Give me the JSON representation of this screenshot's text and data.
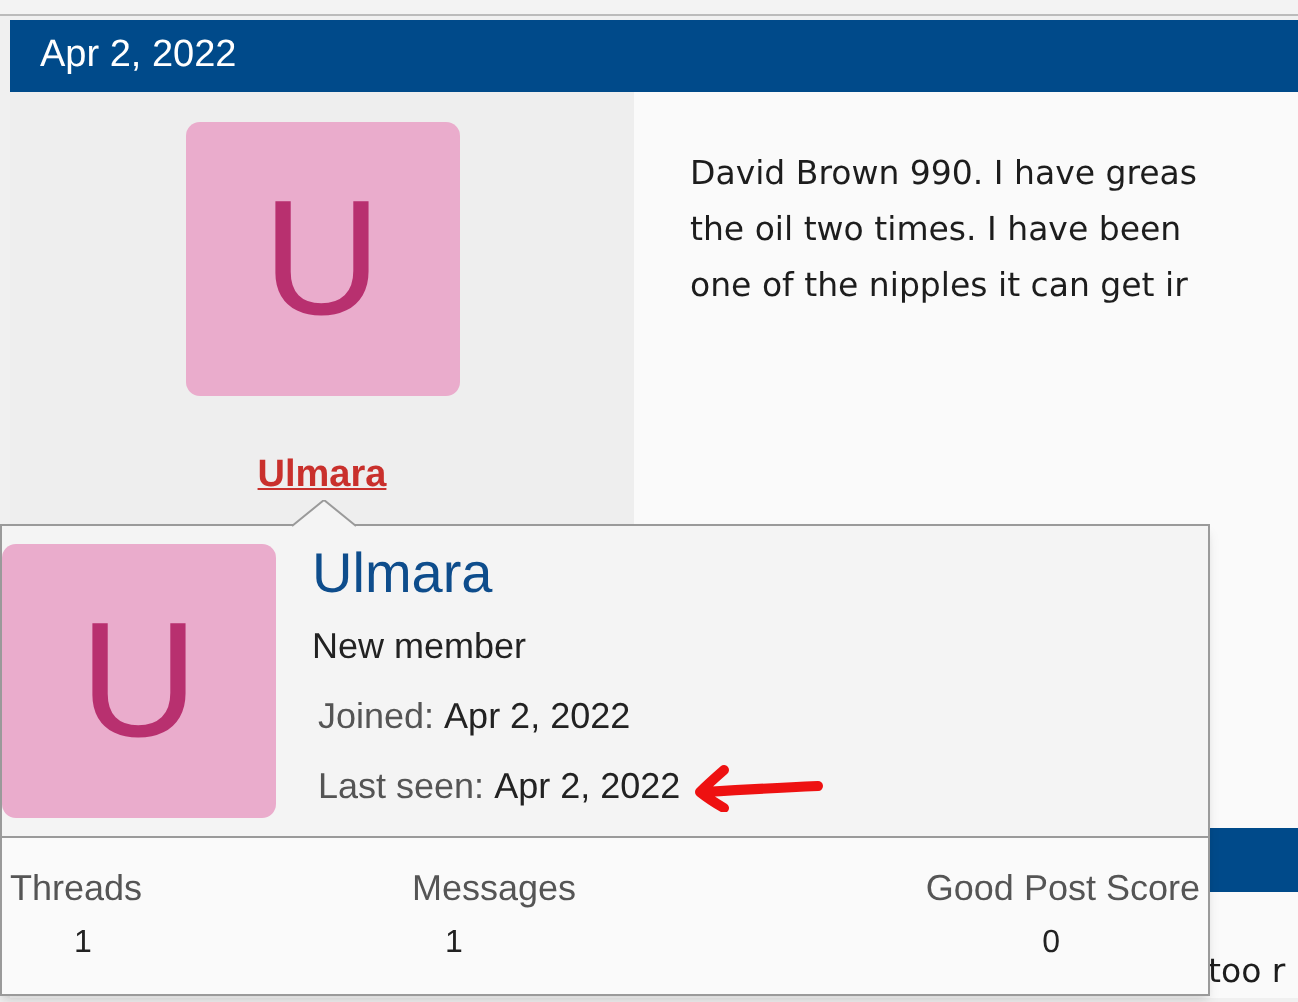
{
  "post": {
    "date": "Apr 2, 2022",
    "avatar_letter": "U",
    "username": "Ulmara",
    "message_lines": [
      "David Brown 990. I have greas",
      "the oil two times. I have been",
      "one of the nipples it can get ir"
    ]
  },
  "next_post": {
    "message_fragment": "too r"
  },
  "member_card": {
    "avatar_letter": "U",
    "username": "Ulmara",
    "user_title": "New member",
    "details": [
      {
        "label": "Joined:",
        "value": "Apr 2, 2022",
        "annotated": false
      },
      {
        "label": "Last seen:",
        "value": "Apr 2, 2022",
        "annotated": true
      }
    ],
    "stats": [
      {
        "label": "Threads",
        "value": "1"
      },
      {
        "label": "Messages",
        "value": "1"
      },
      {
        "label": "Good Post Score",
        "value": "0"
      }
    ]
  }
}
